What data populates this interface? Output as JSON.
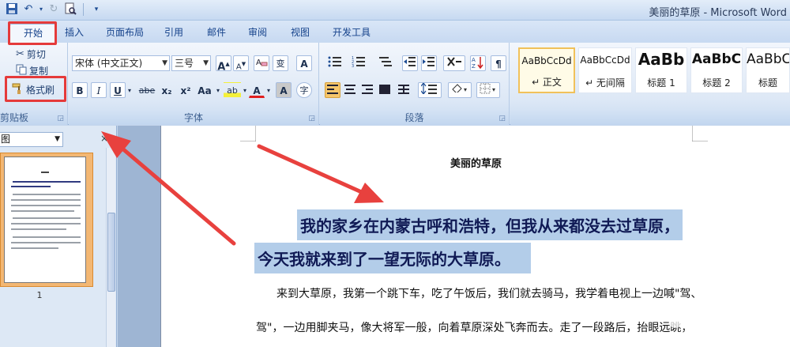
{
  "window": {
    "title": "美丽的草原 - Microsoft Word",
    "quick_access": [
      "save-icon",
      "undo-icon",
      "redo-icon",
      "print-preview-icon"
    ]
  },
  "tabs": [
    "开始",
    "插入",
    "页面布局",
    "引用",
    "邮件",
    "审阅",
    "视图",
    "开发工具"
  ],
  "active_tab": "开始",
  "ribbon": {
    "clipboard": {
      "label": "剪贴板",
      "cut": "剪切",
      "copy": "复制",
      "format_painter": "格式刷"
    },
    "font": {
      "label": "字体",
      "font_name": "宋体 (中文正文)",
      "font_size": "三号",
      "grow": "A",
      "shrink": "A",
      "phonetic": "变",
      "border_char": "A",
      "bold": "B",
      "italic": "I",
      "underline": "U",
      "strikethrough": "abe",
      "subscript": "x₂",
      "superscript": "x²",
      "change_case": "Aa",
      "highlight": "ab",
      "font_color": "A",
      "char_shading": "A",
      "enclose": "字"
    },
    "paragraph": {
      "label": "段落"
    },
    "styles": [
      {
        "sample": "AaBbCcDd",
        "name": "↵ 正文"
      },
      {
        "sample": "AaBbCcDd",
        "name": "↵ 无间隔"
      },
      {
        "sample": "AaBb",
        "name": "标题 1"
      },
      {
        "sample": "AaBbC",
        "name": "标题 2"
      },
      {
        "sample": "AaBbC",
        "name": "标题"
      }
    ]
  },
  "nav_pane": {
    "view": "图",
    "close": "×",
    "page_number": "1"
  },
  "document": {
    "title": "美丽的草原",
    "selected_lines": [
      "我的家乡在内蒙古呼和浩特，但我从来都没去过草原，",
      "今天我就来到了一望无际的大草原。"
    ],
    "body_lines": [
      "来到大草原，我第一个跳下车，吃了午饭后，我们就去骑马，我学着电视上一边喊\"驾、",
      "驾\"，一边用脚夹马，像大将军一般，向着草原深处飞奔而去。走了一段路后，抬眼远眺，"
    ]
  },
  "watermark": "经验",
  "colors": {
    "highlight_box": "#e53a3a",
    "arrow": "#e8413e",
    "selection": "#b3cde9"
  }
}
